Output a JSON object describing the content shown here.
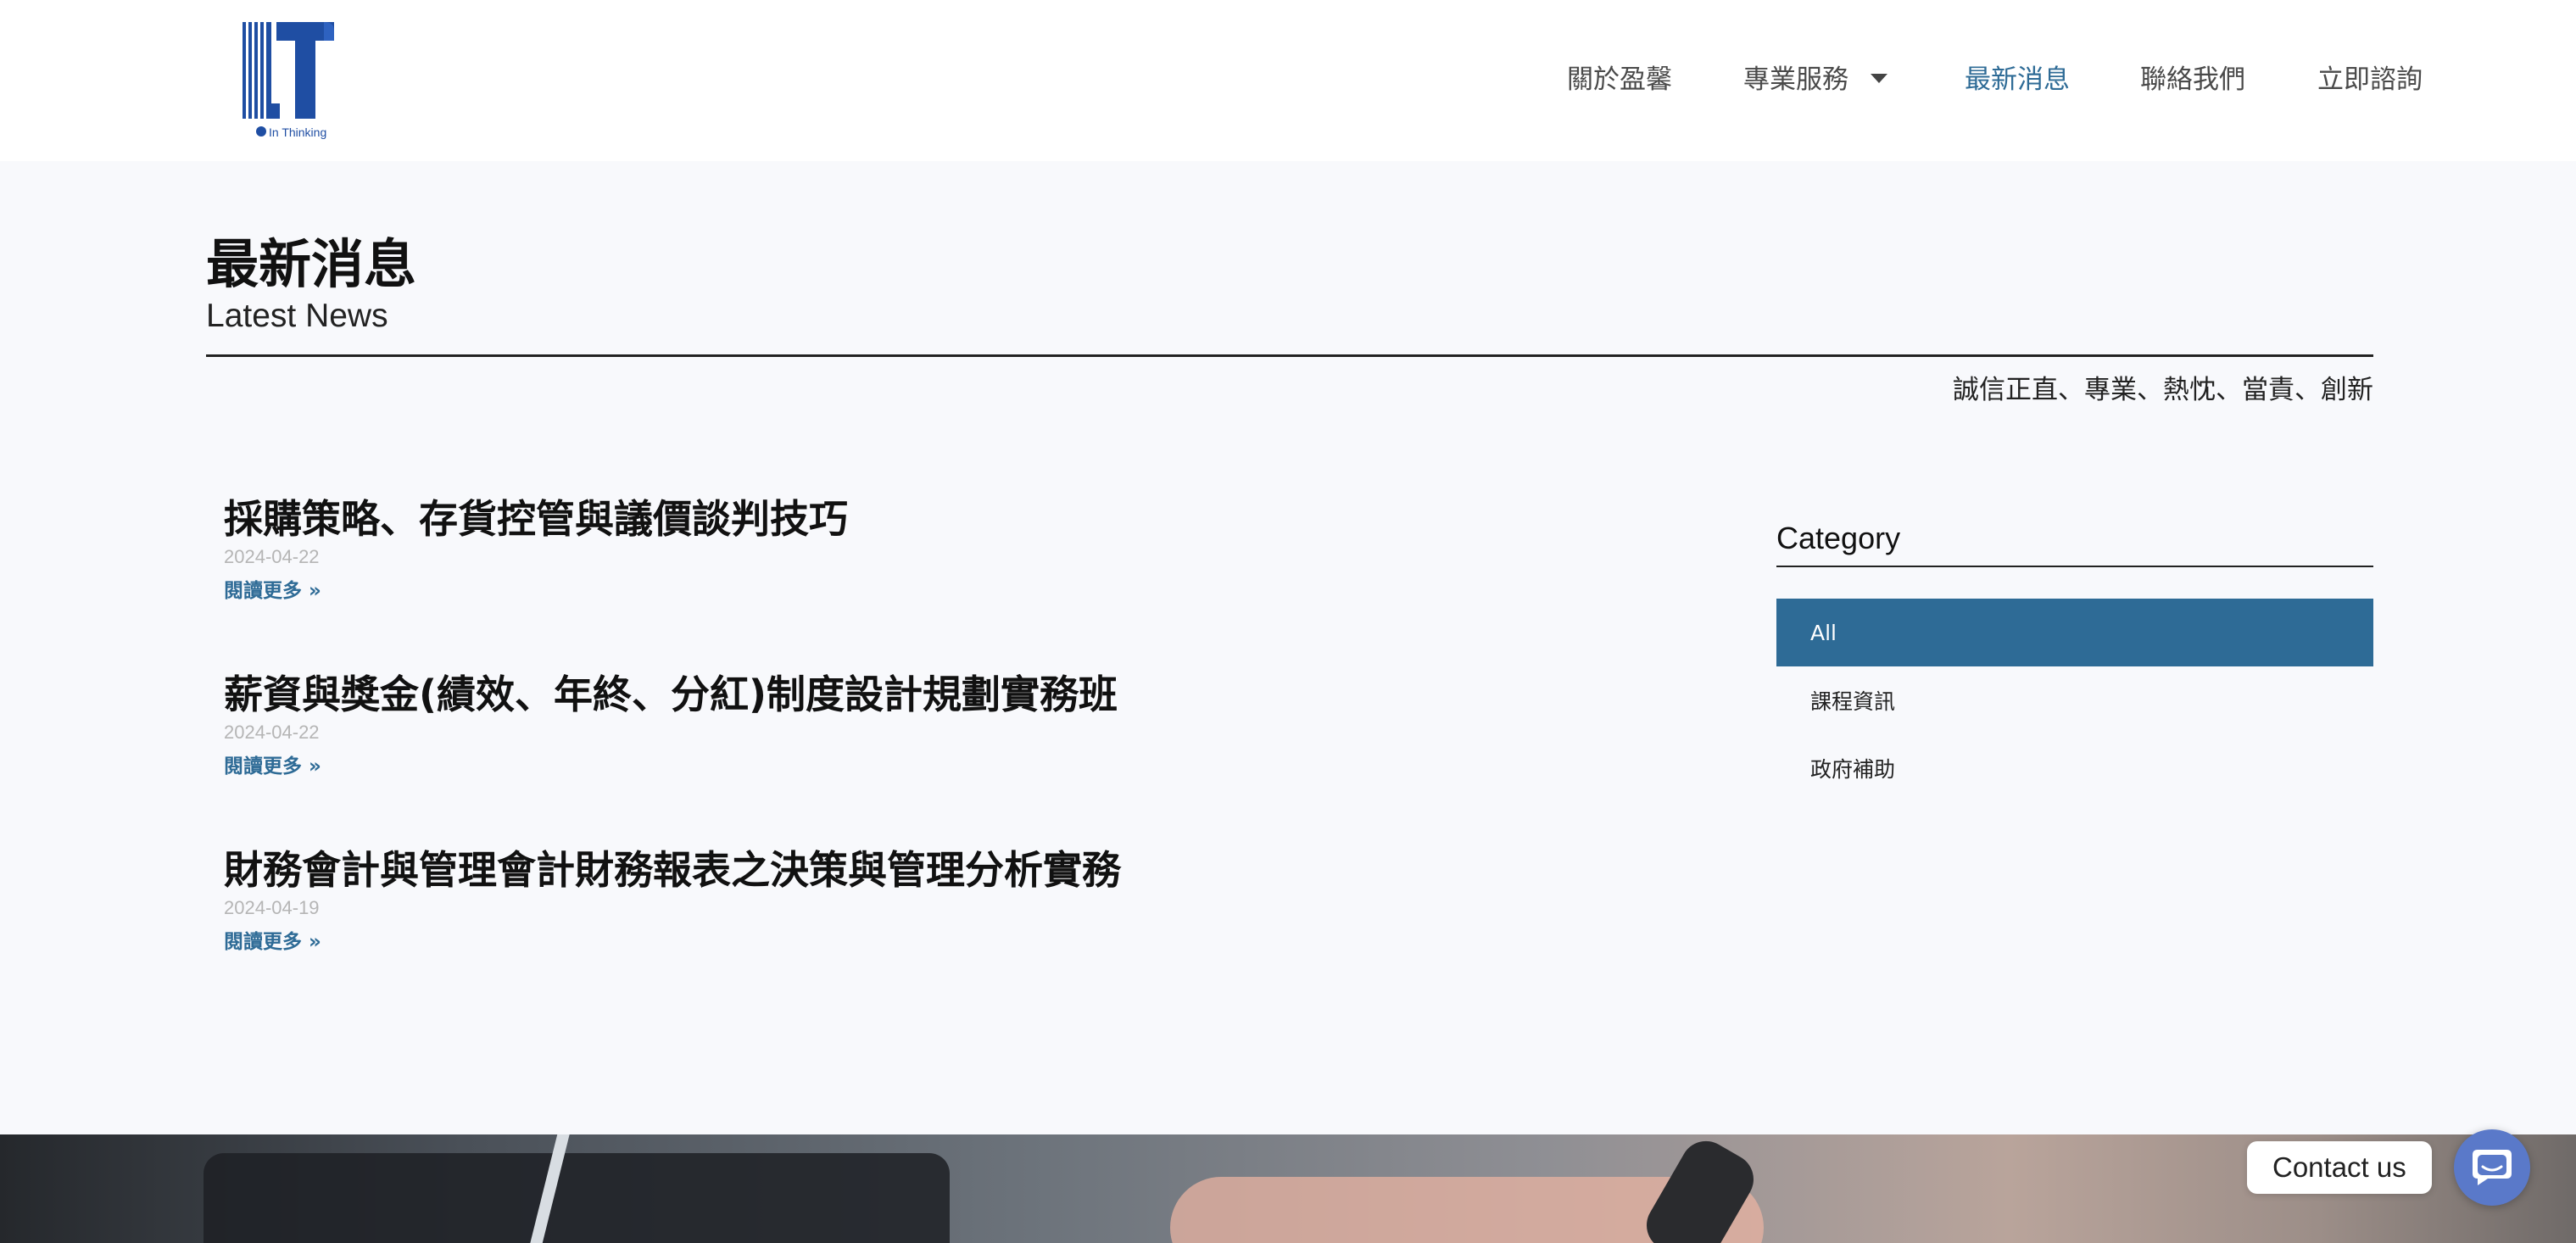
{
  "brand": {
    "logo_text": "In Thinking"
  },
  "nav": {
    "items": [
      {
        "label": "關於盈馨"
      },
      {
        "label": "專業服務"
      },
      {
        "label": "最新消息"
      },
      {
        "label": "聯絡我們"
      },
      {
        "label": "立即諮詢"
      }
    ],
    "active": "最新消息"
  },
  "page": {
    "title": "最新消息",
    "subtitle": "Latest News",
    "values": "誠信正直、專業、熱忱、當責、創新"
  },
  "posts": [
    {
      "title": "採購策略、存貨控管與議價談判技巧",
      "date": "2024-04-22",
      "more": "閱讀更多 »"
    },
    {
      "title": "薪資與獎金(績效、年終、分紅)制度設計規劃實務班",
      "date": "2024-04-22",
      "more": "閱讀更多 »"
    },
    {
      "title": "財務會計與管理會計財務報表之決策與管理分析實務",
      "date": "2024-04-19",
      "more": "閱讀更多 »"
    }
  ],
  "sidebar": {
    "heading": "Category",
    "items": [
      {
        "label": "All"
      },
      {
        "label": "課程資訊"
      },
      {
        "label": "政府補助"
      }
    ]
  },
  "contact": {
    "label": "Contact us"
  },
  "colors": {
    "accent": "#2e6b96",
    "logo_blue": "#1f4ea3",
    "background": "#f8f9fc",
    "contact_button": "#5a79c9"
  }
}
